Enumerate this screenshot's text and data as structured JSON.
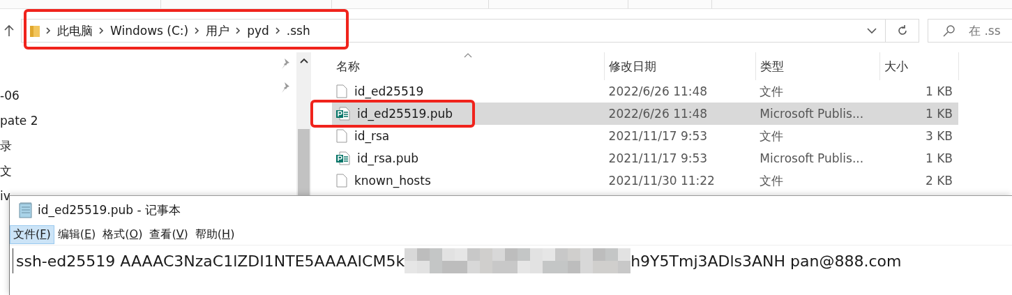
{
  "address_bar": {
    "highlighted": true,
    "path": [
      {
        "label": "此电脑"
      },
      {
        "label": "Windows (C:)"
      },
      {
        "label": "用户"
      },
      {
        "label": "pyd"
      },
      {
        "label": ".ssh"
      }
    ],
    "search": {
      "placeholder": "在 .ss"
    }
  },
  "nav_pane": {
    "items": [
      "-06",
      "pate 2",
      "录",
      "文",
      "iv"
    ]
  },
  "columns": [
    {
      "label": "名称",
      "sorted": true
    },
    {
      "label": "修改日期",
      "sorted": false
    },
    {
      "label": "类型",
      "sorted": false
    },
    {
      "label": "大小",
      "sorted": false
    }
  ],
  "files": [
    {
      "name": "id_ed25519",
      "modified": "2022/6/26 11:48",
      "type": "文件",
      "size": "1 KB",
      "kind": "file",
      "selected": false,
      "highlighted": false
    },
    {
      "name": "id_ed25519.pub",
      "modified": "2022/6/26 11:48",
      "type": "Microsoft Publis...",
      "size": "1 KB",
      "kind": "publisher",
      "selected": true,
      "highlighted": true
    },
    {
      "name": "id_rsa",
      "modified": "2021/11/17 9:53",
      "type": "文件",
      "size": "3 KB",
      "kind": "file",
      "selected": false,
      "highlighted": false
    },
    {
      "name": "id_rsa.pub",
      "modified": "2021/11/17 9:53",
      "type": "Microsoft Publis...",
      "size": "1 KB",
      "kind": "publisher",
      "selected": false,
      "highlighted": false
    },
    {
      "name": "known_hosts",
      "modified": "2021/11/30 11:22",
      "type": "文件",
      "size": "2 KB",
      "kind": "file",
      "selected": false,
      "highlighted": false
    }
  ],
  "notepad": {
    "title": "id_ed25519.pub - 记事本",
    "menu": [
      {
        "before": "文件(",
        "key": "F",
        "after": ")",
        "selected": true
      },
      {
        "before": "编辑(",
        "key": "E",
        "after": ")",
        "selected": false
      },
      {
        "before": "格式(",
        "key": "O",
        "after": ")",
        "selected": false
      },
      {
        "before": "查看(",
        "key": "V",
        "after": ")",
        "selected": false
      },
      {
        "before": "帮助(",
        "key": "H",
        "after": ")",
        "selected": false
      }
    ],
    "content": [
      {
        "kind": "text",
        "text": "ssh-ed25519 AAAAC3NzaC1lZDI1NTE5AAAAICM5k"
      },
      {
        "kind": "redacted"
      },
      {
        "kind": "text",
        "text": "h9Y5Tmj3ADls3ANH pan@888.com"
      }
    ]
  }
}
